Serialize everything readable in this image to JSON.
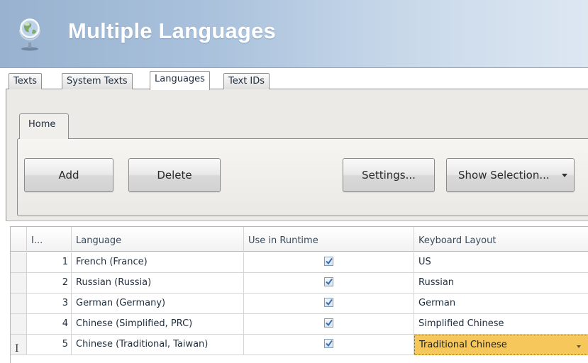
{
  "header": {
    "title": "Multiple Languages",
    "icon": "globe-icon"
  },
  "tabs": [
    {
      "label": "Texts"
    },
    {
      "label": "System Texts"
    },
    {
      "label": "Languages"
    },
    {
      "label": "Text IDs"
    }
  ],
  "active_tab": "Languages",
  "ribbon": {
    "tab_label": "Home",
    "buttons": {
      "add": "Add",
      "delete": "Delete",
      "settings": "Settings...",
      "show_selection": "Show Selection..."
    }
  },
  "grid": {
    "columns": [
      "I...",
      "Language",
      "Use in Runtime",
      "Keyboard Layout"
    ],
    "rows": [
      {
        "id": "1",
        "language": "French (France)",
        "use_in_runtime": true,
        "keyboard_layout": "US"
      },
      {
        "id": "2",
        "language": "Russian (Russia)",
        "use_in_runtime": true,
        "keyboard_layout": "Russian"
      },
      {
        "id": "3",
        "language": "German (Germany)",
        "use_in_runtime": true,
        "keyboard_layout": "German"
      },
      {
        "id": "4",
        "language": "Chinese (Simplified, PRC)",
        "use_in_runtime": true,
        "keyboard_layout": "Simplified Chinese"
      },
      {
        "id": "5",
        "language": "Chinese (Traditional, Taiwan)",
        "use_in_runtime": true,
        "keyboard_layout": "Traditional Chinese"
      }
    ],
    "selected_row_indicator": "I"
  },
  "colors": {
    "header_gradient_start": "#98b2cf",
    "header_gradient_end": "#dde7f2",
    "selected_cell": "#f6c75a",
    "checkbox_check": "#3a6fb5"
  }
}
